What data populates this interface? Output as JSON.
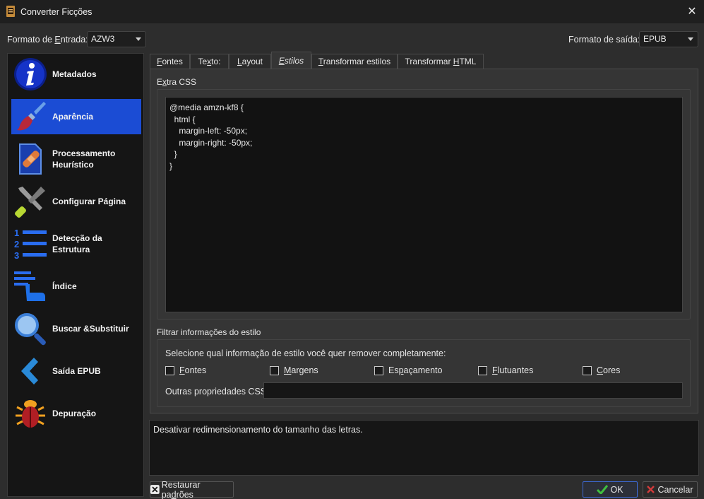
{
  "window": {
    "title": "Converter Ficções"
  },
  "input_format": {
    "label": "Formato de Entrada:",
    "value": "AZW3"
  },
  "output_format": {
    "label": "Formato de saída:",
    "value": "EPUB"
  },
  "sidebar": {
    "items": [
      {
        "label": "Metadados",
        "icon": "info-icon"
      },
      {
        "label": "Aparência",
        "icon": "paintbrush-icon",
        "active": true
      },
      {
        "label": "Processamento Heurístico",
        "icon": "document-bandage-icon"
      },
      {
        "label": "Configurar Página",
        "icon": "tools-icon"
      },
      {
        "label": "Detecção da Estrutura",
        "icon": "numbered-list-icon"
      },
      {
        "label": "Índice",
        "icon": "toc-hand-icon"
      },
      {
        "label": "Buscar &Substituir",
        "icon": "magnifier-icon"
      },
      {
        "label": "Saída EPUB",
        "icon": "chevron-left-icon"
      },
      {
        "label": "Depuração",
        "icon": "bug-icon"
      }
    ]
  },
  "tabs": [
    "Fontes",
    "Texto:",
    "Layout",
    "Estilos",
    "Transformar estilos",
    "Transformar HTML"
  ],
  "active_tab": "Estilos",
  "extra_css": {
    "title": "Extra CSS",
    "content": "@media amzn-kf8 {\n  html {\n    margin-left: -50px;\n    margin-right: -50px;\n  }\n}"
  },
  "filter": {
    "title": "Filtrar informações do estilo",
    "prompt": "Selecione qual informação de estilo você quer remover completamente:",
    "options": [
      "Fontes",
      "Margens",
      "Espaçamento",
      "Flutuantes",
      "Cores"
    ],
    "other_label": "Outras propriedades CSS:",
    "other_value": ""
  },
  "description": "Desativar redimensionamento do tamanho das letras.",
  "buttons": {
    "restore": "Restaurar padrões",
    "ok": "OK",
    "cancel": "Cancelar"
  },
  "colors": {
    "accent": "#1b4cd4",
    "ok_check": "#3fbf3f",
    "cancel_x": "#d13b3b"
  }
}
